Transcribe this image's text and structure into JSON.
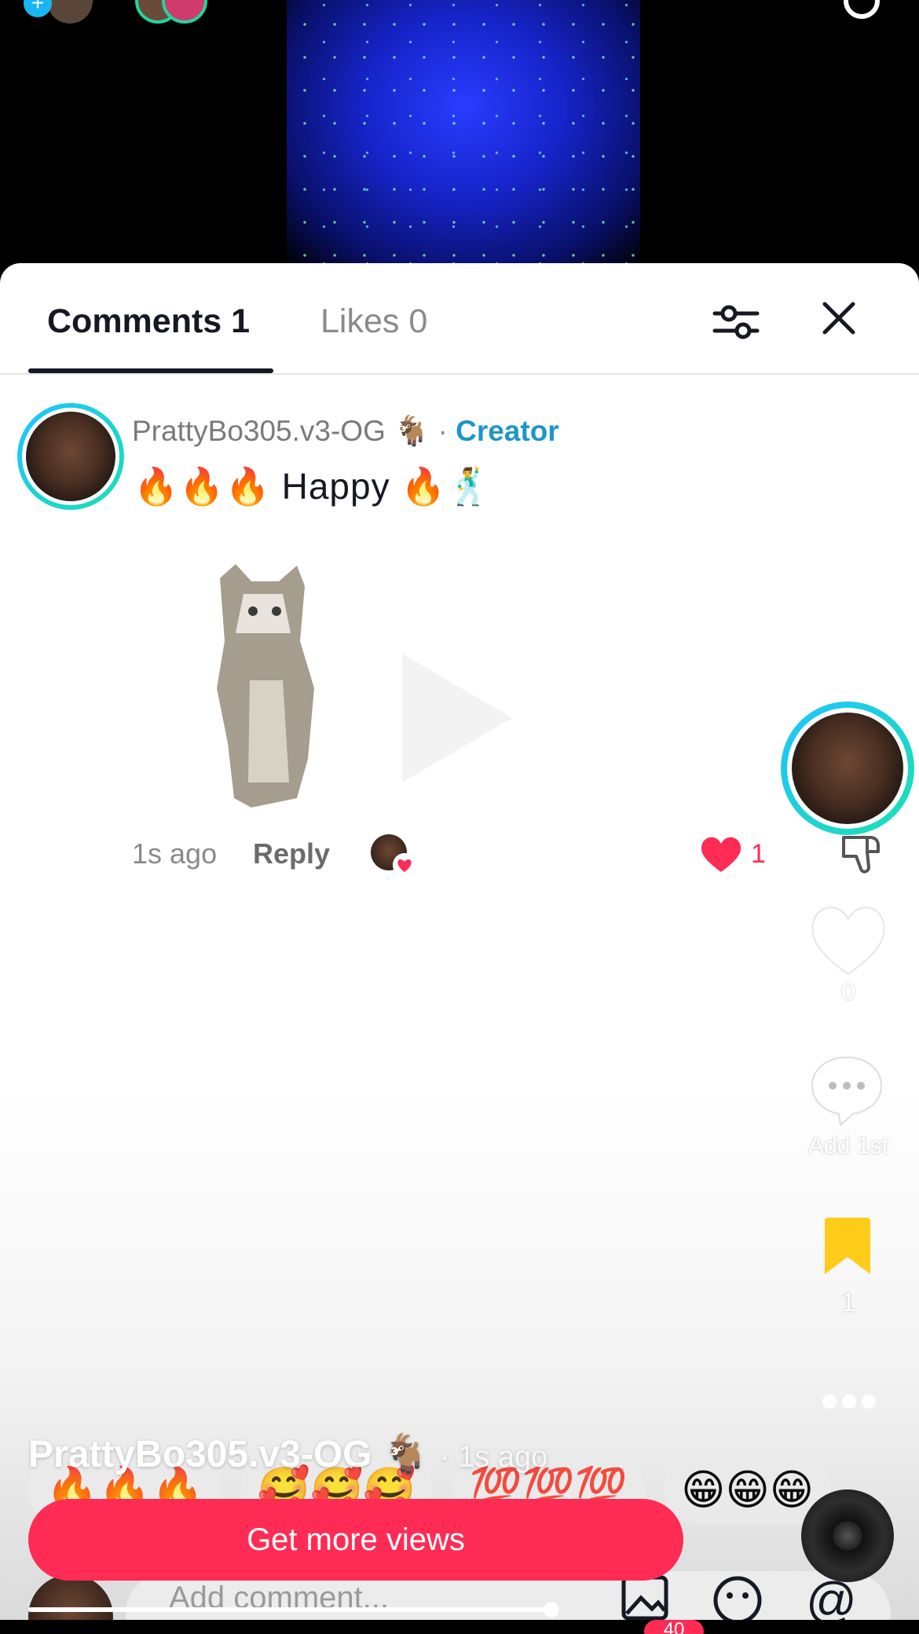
{
  "tabs": {
    "comments": "Comments 1",
    "likes": "Likes 0"
  },
  "comment": {
    "username": "PrattyBo305.v3-OG 🐐",
    "separator": "·",
    "role": "Creator",
    "text": "🔥🔥🔥 Happy 🔥🕺",
    "time": "1s ago",
    "reply": "Reply",
    "like_count": "1"
  },
  "rail": {
    "heart_count": "0",
    "comment_label": "Add 1st",
    "bookmark_count": "1"
  },
  "caption": {
    "username": "PrattyBo305.v3-OG 🐐",
    "time": "· 1s ago"
  },
  "quick_emojis": [
    "🔥🔥🔥",
    "🥰🥰🥰",
    "💯💯💯",
    "😁😁😁"
  ],
  "cta_label": "Get more views",
  "compose": {
    "placeholder": "Add comment..."
  },
  "badge": "40",
  "colors": {
    "accent": "#fe2c55",
    "creator": "#1d96c8",
    "bookmark": "#ffcc1a",
    "ring": "#1de0b0"
  },
  "icons": {
    "filter": "filter-icon",
    "close": "close-icon",
    "heart": "heart-icon",
    "dislike": "dislike-icon",
    "comment": "comment-bubble-icon",
    "bookmark": "bookmark-icon",
    "more": "more-dots-icon",
    "image": "image-icon",
    "emoji": "emoji-icon",
    "mention": "at-sign-icon"
  }
}
